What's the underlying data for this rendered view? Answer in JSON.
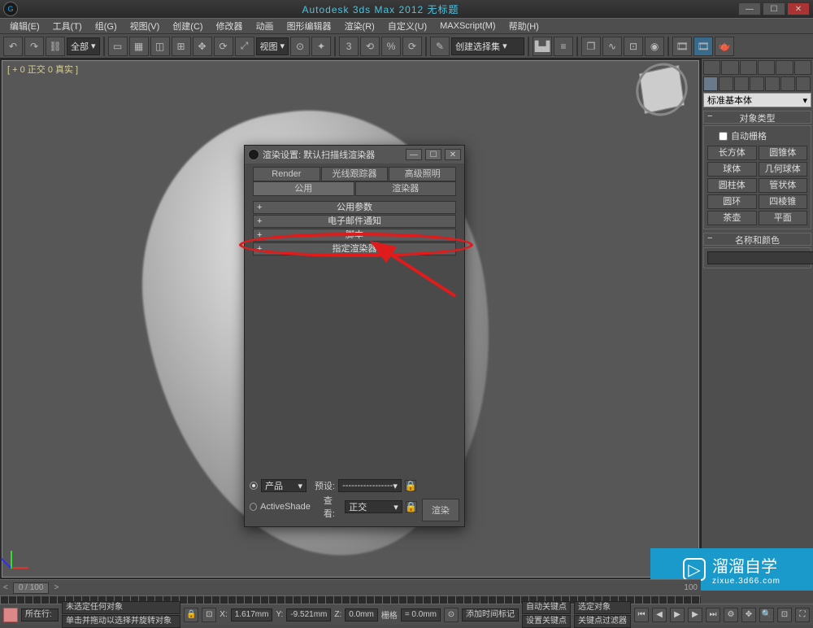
{
  "titlebar": {
    "title": "Autodesk 3ds Max  2012        无标题"
  },
  "menu": [
    "编辑(E)",
    "工具(T)",
    "组(G)",
    "视图(V)",
    "创建(C)",
    "修改器",
    "动画",
    "图形编辑器",
    "渲染(R)",
    "自定义(U)",
    "MAXScript(M)",
    "帮助(H)"
  ],
  "toolbar": {
    "scope": "全部",
    "viewDrop": "视图",
    "selectSet": "创建选择集"
  },
  "viewport": {
    "label": "[ + 0 正交 0 真实 ]"
  },
  "cmd": {
    "typeDrop": "标准基本体",
    "rollout1": "对象类型",
    "autogrid": "自动栅格",
    "prims": [
      "长方体",
      "圆锥体",
      "球体",
      "几何球体",
      "圆柱体",
      "管状体",
      "圆环",
      "四棱锥",
      "茶壶",
      "平面"
    ],
    "rollout2": "名称和颜色"
  },
  "dialog": {
    "title": "渲染设置: 默认扫描线渲染器",
    "tabs1": [
      "Render Elements",
      "光线跟踪器",
      "高级照明"
    ],
    "tabs2": [
      "公用",
      "渲染器"
    ],
    "rolls": [
      "公用参数",
      "电子邮件通知",
      "脚本",
      "指定渲染器"
    ],
    "productLabel": "产品",
    "activeShadeLabel": "ActiveShade",
    "presetLabel": "预设:",
    "presetValue": "-----------------",
    "viewLabel": "查看:",
    "viewValue": "正交",
    "renderBtn": "渲染"
  },
  "timeslider": {
    "label": "0 / 100",
    "endtick": "100"
  },
  "status": {
    "rowLabel": "所在行:",
    "hint1": "未选定任何对象",
    "hint2": "单击并拖动以选择并旋转对象",
    "xLabel": "X:",
    "x": "1.617mm",
    "yLabel": "Y:",
    "y": "-9.521mm",
    "zLabel": "Z:",
    "z": "0.0mm",
    "gridLabel": "栅格",
    "grid": "= 0.0mm",
    "addTime": "添加时间标记",
    "autokey": "自动关键点",
    "selKey": "选定对象",
    "setkey": "设置关键点",
    "keyfilter": "关键点过滤器"
  },
  "watermark": {
    "big": "溜溜自学",
    "small": "zixue.3d66.com"
  }
}
